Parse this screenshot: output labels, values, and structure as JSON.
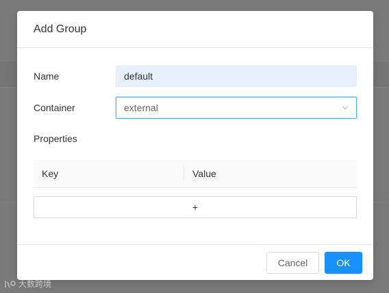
{
  "dialog": {
    "title": "Add Group",
    "name_label": "Name",
    "name_value": "default",
    "container_label": "Container",
    "container_value": "external",
    "properties_label": "Properties",
    "table": {
      "columns": [
        "Key",
        "Value"
      ]
    },
    "add_row_label": "+",
    "cancel_label": "Cancel",
    "ok_label": "OK"
  },
  "watermark": {
    "text": "大数跨境"
  },
  "colors": {
    "primary": "#1890ff",
    "focus_border": "#40a9ff",
    "autofill_bg": "#e8f0fe",
    "overlay": "#7a7a7a"
  },
  "icons": {
    "container_dropdown": "chevron-down-icon",
    "watermark_logo": "logo-icon"
  }
}
